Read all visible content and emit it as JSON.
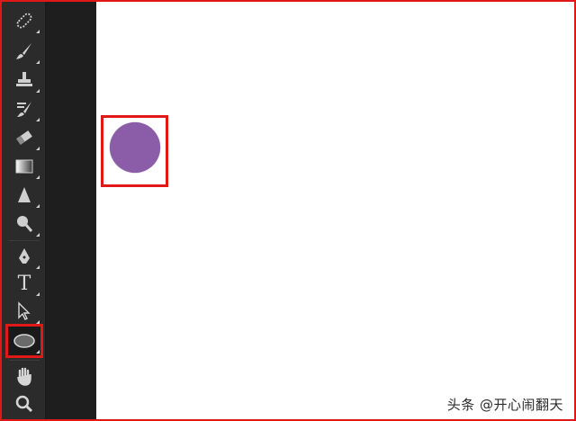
{
  "tools": [
    {
      "name": "healing-brush-tool",
      "icon": "bandage-icon"
    },
    {
      "name": "brush-tool",
      "icon": "brush-icon"
    },
    {
      "name": "clone-stamp-tool",
      "icon": "stamp-icon"
    },
    {
      "name": "history-brush-tool",
      "icon": "history-brush-icon"
    },
    {
      "name": "eraser-tool",
      "icon": "eraser-icon"
    },
    {
      "name": "gradient-tool",
      "icon": "gradient-icon"
    },
    {
      "name": "blur-tool",
      "icon": "droplet-icon"
    },
    {
      "name": "dodge-tool",
      "icon": "dodge-icon"
    },
    {
      "name": "pen-tool",
      "icon": "pen-icon"
    },
    {
      "name": "type-tool",
      "icon": "type-icon",
      "label": "T"
    },
    {
      "name": "path-selection-tool",
      "icon": "arrow-icon"
    },
    {
      "name": "ellipse-tool",
      "icon": "ellipse-icon",
      "active": true
    },
    {
      "name": "hand-tool",
      "icon": "hand-icon"
    },
    {
      "name": "zoom-tool",
      "icon": "magnifier-icon"
    }
  ],
  "canvas": {
    "shape": "circle",
    "fill_color": "#8b5ca8"
  },
  "colors": {
    "highlight": "#e01818",
    "toolbar_bg": "#2b2b2b",
    "canvas_bg": "#ffffff"
  },
  "watermark": "头条 @开心闹翻天"
}
